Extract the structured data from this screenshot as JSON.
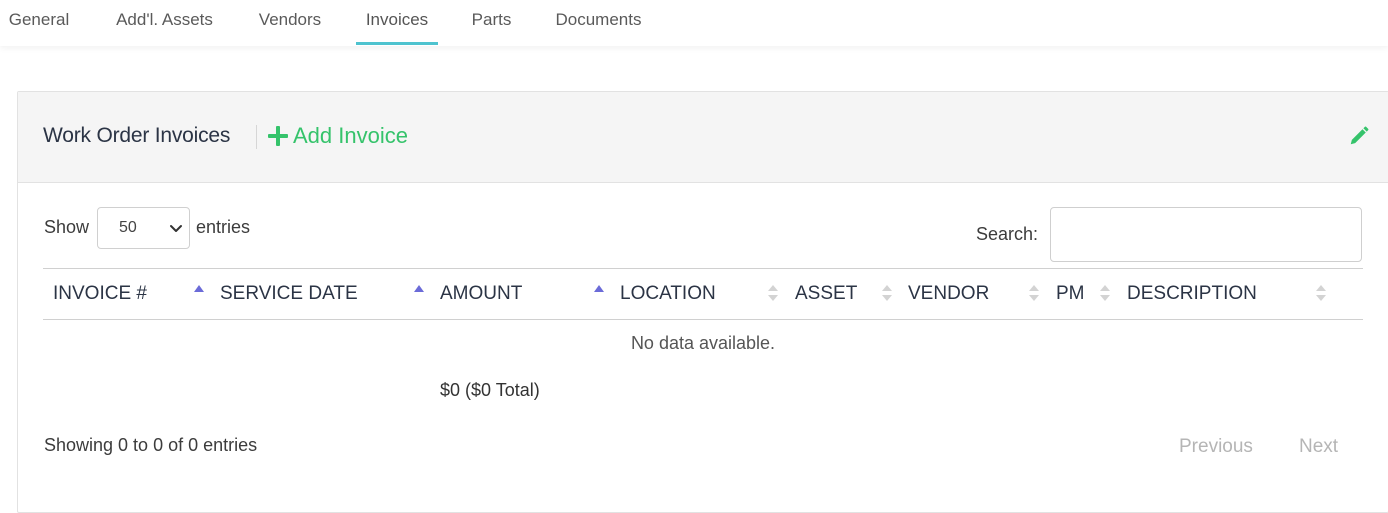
{
  "tabs": [
    {
      "label": "General"
    },
    {
      "label": "Add'l. Assets"
    },
    {
      "label": "Vendors"
    },
    {
      "label": "Invoices"
    },
    {
      "label": "Parts"
    },
    {
      "label": "Documents"
    }
  ],
  "active_tab": "Invoices",
  "colors": {
    "accent_green": "#35c36b",
    "tab_underline": "#4ec3cf",
    "sort_active": "#6b6bd8"
  },
  "card": {
    "title": "Work Order Invoices",
    "add_label": "Add Invoice",
    "add_icon": "plus-icon",
    "edit_icon": "pencil-icon"
  },
  "controls": {
    "show_label": "Show",
    "page_length": "50",
    "entries_label": "entries",
    "search_label": "Search:",
    "search_value": ""
  },
  "table": {
    "columns": [
      {
        "label": "INVOICE #",
        "sort": "asc"
      },
      {
        "label": "SERVICE DATE",
        "sort": "asc"
      },
      {
        "label": "AMOUNT",
        "sort": "asc"
      },
      {
        "label": "LOCATION",
        "sort": "none"
      },
      {
        "label": "ASSET",
        "sort": "none"
      },
      {
        "label": "VENDOR",
        "sort": "none"
      },
      {
        "label": "PM",
        "sort": "none"
      },
      {
        "label": "DESCRIPTION",
        "sort": "none"
      }
    ],
    "empty_message": "No data available.",
    "amount_total": "$0 ($0 Total)"
  },
  "footer": {
    "info": "Showing 0 to 0 of 0 entries",
    "previous": "Previous",
    "next": "Next"
  }
}
